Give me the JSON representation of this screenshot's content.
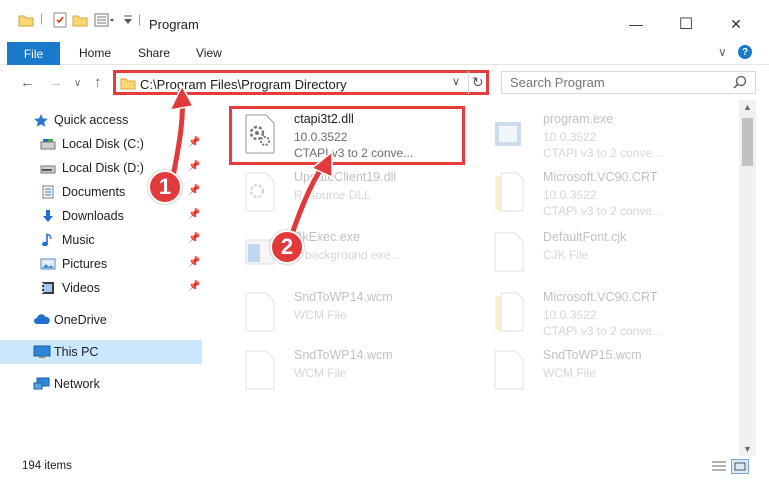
{
  "window": {
    "title": "Program",
    "minimize_glyph": "—",
    "maximize_glyph": "☐",
    "close_glyph": "✕"
  },
  "ribbon": {
    "tabs": [
      "File",
      "Home",
      "Share",
      "View"
    ],
    "expand_glyph": "∨",
    "help_glyph": "?"
  },
  "address": {
    "path": "C:\\Program Files\\Program Directory",
    "search_placeholder": "Search Program"
  },
  "nav_pane": {
    "quick_access_label": "Quick access",
    "items": [
      {
        "label": "Local Disk (C:)",
        "icon": "drive-icon",
        "pinned": true
      },
      {
        "label": "Local Disk (D:)",
        "icon": "drive-icon",
        "pinned": true
      },
      {
        "label": "Documents",
        "icon": "documents-icon",
        "pinned": true
      },
      {
        "label": "Downloads",
        "icon": "downloads-icon",
        "pinned": true
      },
      {
        "label": "Music",
        "icon": "music-icon",
        "pinned": true
      },
      {
        "label": "Pictures",
        "icon": "pictures-icon",
        "pinned": true
      },
      {
        "label": "Videos",
        "icon": "videos-icon",
        "pinned": true
      }
    ],
    "onedrive_label": "OneDrive",
    "this_pc_label": "This PC",
    "network_label": "Network"
  },
  "files": [
    {
      "name": "ctapi3t2.dll",
      "line2": "10.0.3522",
      "line3": "CTAPI v3 to 2 conve...",
      "icon": "dll-icon",
      "faded": false
    },
    {
      "name": "program.exe",
      "line2": "10.0.3522",
      "line3": "CTAPI v3 to 2 conve...",
      "icon": "exe-icon",
      "faded": true
    },
    {
      "name": "UpdateClient19.dll",
      "line2": "Resource DLL",
      "line3": "",
      "icon": "dll-icon",
      "faded": true
    },
    {
      "name": "Microsoft.VC90.CRT",
      "line2": "10.0.3522",
      "line3": "CTAPI v3 to 2 conve...",
      "icon": "folder-file-icon",
      "faded": true
    },
    {
      "name": "BkExec.exe",
      "line2": "Y background exe...",
      "line3": "",
      "icon": "exe-icon",
      "faded": true
    },
    {
      "name": "DefaultFont.cjk",
      "line2": "CJK File",
      "line3": "",
      "icon": "file-icon",
      "faded": true
    },
    {
      "name": "SndToWP14.wcm",
      "line2": "WCM File",
      "line3": "",
      "icon": "file-icon",
      "faded": true
    },
    {
      "name": "Microsoft.VC90.CRT",
      "line2": "10.0.3522",
      "line3": "CTAPI v3 to 2 conve...",
      "icon": "folder-file-icon",
      "faded": true
    },
    {
      "name": "SndToWP14.wcm",
      "line2": "WCM File",
      "line3": "",
      "icon": "file-icon",
      "faded": true
    },
    {
      "name": "SndToWP15.wcm",
      "line2": "WCM File",
      "line3": "",
      "icon": "file-icon",
      "faded": true
    }
  ],
  "status": {
    "item_count": "194 items"
  },
  "annotations": {
    "step1": "1",
    "step2": "2"
  },
  "colors": {
    "accent": "#1979ca",
    "highlight_red": "#e63c3c",
    "selected_bg": "#cce8ff"
  }
}
